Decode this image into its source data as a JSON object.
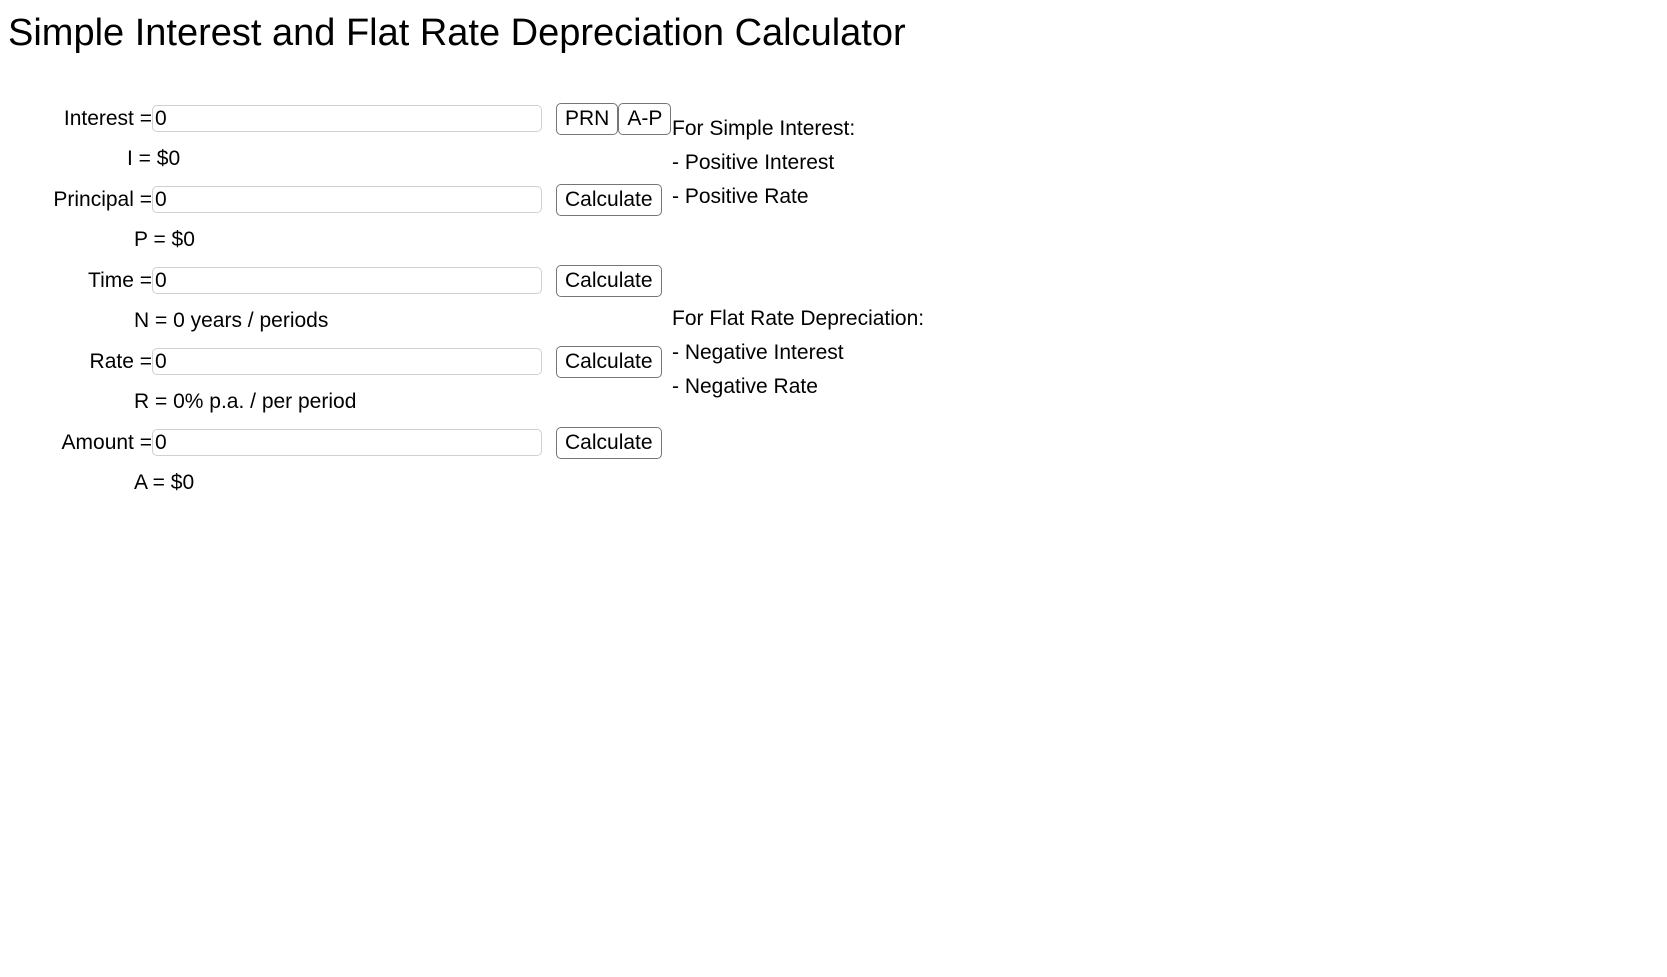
{
  "page": {
    "title": "Simple Interest and Flat Rate Depreciation Calculator"
  },
  "calculator": {
    "rows": [
      {
        "label": "Interest =",
        "value": "0",
        "result": "I = $0",
        "buttons": [
          "PRN",
          "A-P"
        ]
      },
      {
        "label": "Principal =",
        "value": "0",
        "result": "P = $0",
        "buttons": [
          "Calculate"
        ]
      },
      {
        "label": "Time =",
        "value": "0",
        "result": "N = 0 years / periods",
        "buttons": [
          "Calculate"
        ]
      },
      {
        "label": "Rate =",
        "value": "0",
        "result": "R = 0% p.a. / per period",
        "buttons": [
          "Calculate"
        ]
      },
      {
        "label": "Amount =",
        "value": "0",
        "result": "A = $0",
        "buttons": [
          "Calculate"
        ]
      }
    ]
  },
  "notes": {
    "simple_interest": {
      "heading": "For Simple Interest:",
      "line1": "- Positive Interest",
      "line2": "- Positive Rate"
    },
    "flat_rate": {
      "heading": "For Flat Rate Depreciation:",
      "line1": "- Negative Interest",
      "line2": "- Negative Rate"
    }
  },
  "colors": {
    "text": "#000000",
    "background": "#ffffff",
    "input_border": "#d0d0d0",
    "button_border": "#767676"
  }
}
